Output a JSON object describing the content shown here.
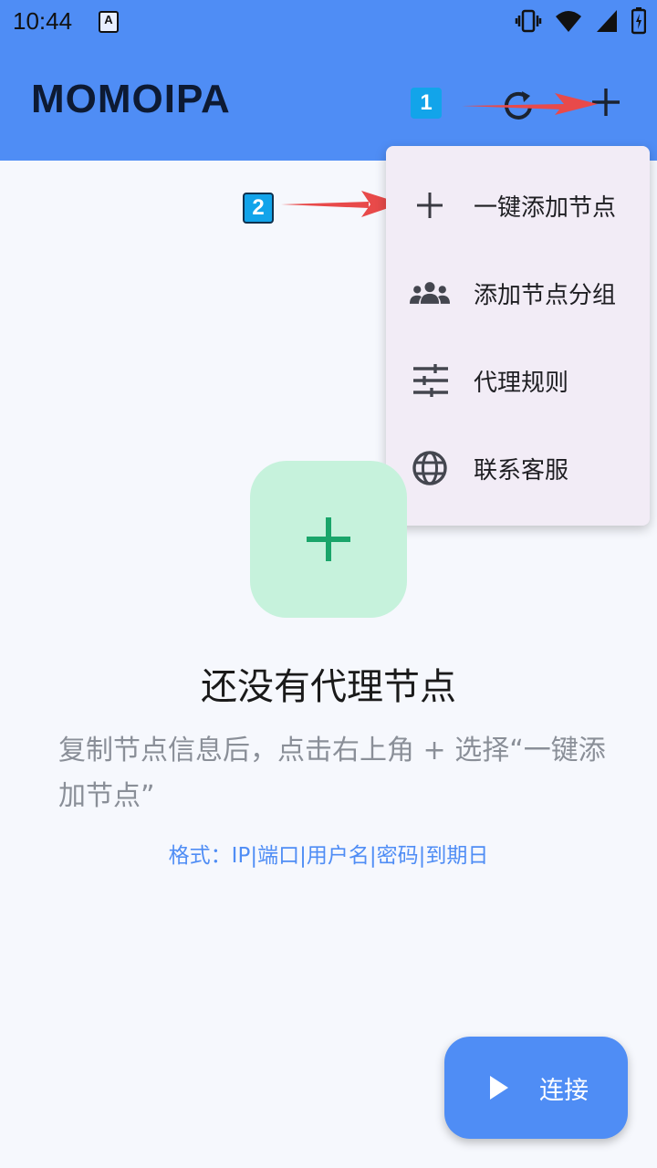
{
  "status_bar": {
    "time": "10:44",
    "app_badge": "A"
  },
  "app_bar": {
    "title": "MOMOIPA",
    "refresh_icon": "refresh-icon",
    "add_icon": "plus-icon"
  },
  "annotations": {
    "badge1": "1",
    "badge2": "2",
    "arrow_color": "#e84a4a"
  },
  "menu": {
    "items": [
      {
        "label": "一键添加节点",
        "icon": "plus-icon"
      },
      {
        "label": "添加节点分组",
        "icon": "group-icon"
      },
      {
        "label": "代理规则",
        "icon": "tune-icon"
      },
      {
        "label": "联系客服",
        "icon": "globe-icon"
      }
    ]
  },
  "empty_state": {
    "title": "还没有代理节点",
    "description": "复制节点信息后，点击右上角 + 选择“一键添加节点”",
    "format_hint": "格式：IP|端口|用户名|密码|到期日"
  },
  "fab": {
    "label": "连接",
    "icon": "play-icon"
  },
  "colors": {
    "primary": "#4f8df5",
    "menu_bg": "#f2ecf6",
    "tile_bg": "#c6f2dc",
    "tile_plus": "#1aa56a"
  }
}
